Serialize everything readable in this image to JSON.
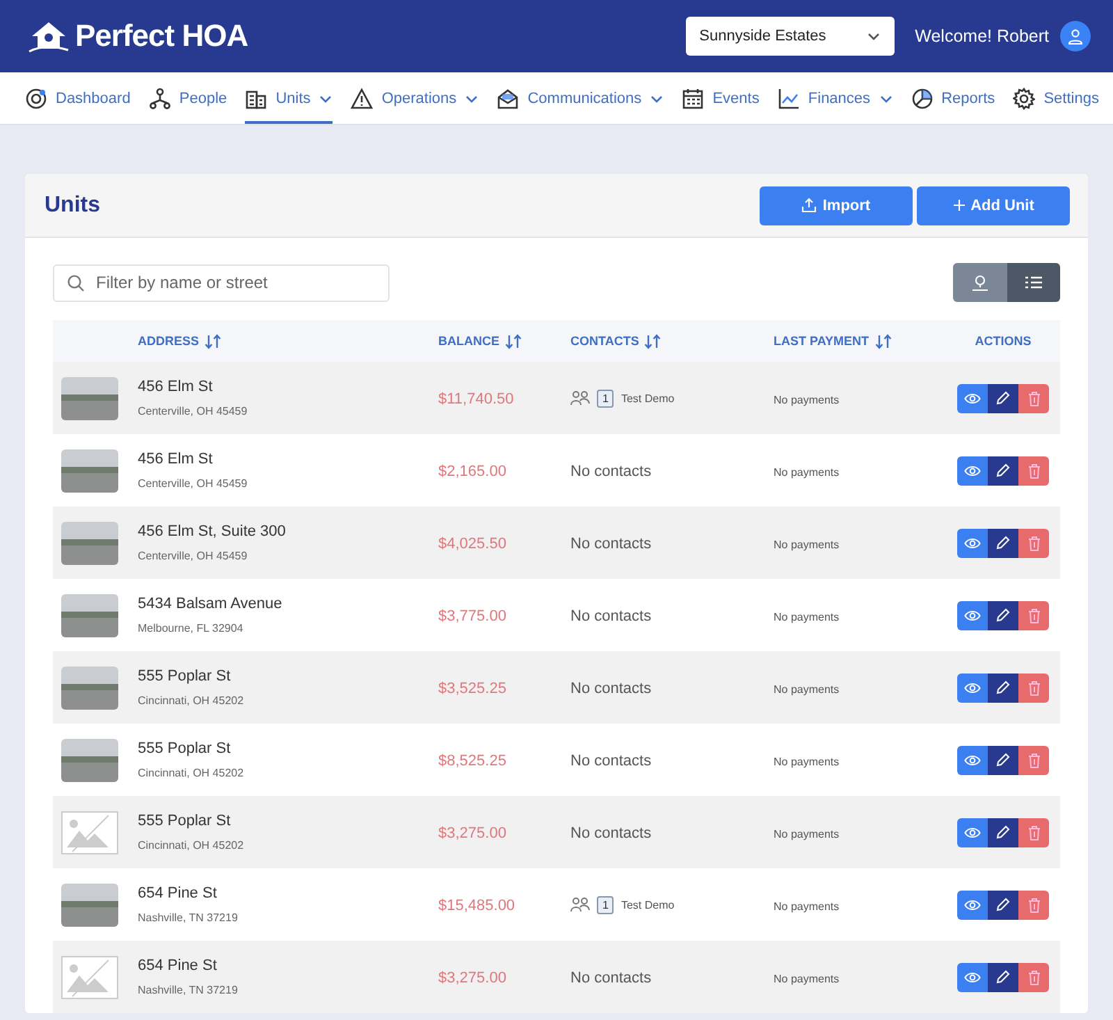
{
  "header": {
    "logo": "Perfect HOA",
    "community_select": "Sunnyside Estates",
    "welcome": "Welcome! Robert"
  },
  "nav": [
    {
      "label": "Dashboard",
      "menu": false,
      "selected": false
    },
    {
      "label": "People",
      "menu": false,
      "selected": false
    },
    {
      "label": "Units",
      "menu": true,
      "selected": true
    },
    {
      "label": "Operations",
      "menu": true,
      "selected": false
    },
    {
      "label": "Communications",
      "menu": true,
      "selected": false
    },
    {
      "label": "Events",
      "menu": false,
      "selected": false
    },
    {
      "label": "Finances",
      "menu": true,
      "selected": false
    },
    {
      "label": "Reports",
      "menu": false,
      "selected": false
    },
    {
      "label": "Settings",
      "menu": false,
      "selected": false
    }
  ],
  "page": {
    "title": "Units",
    "buttons": [
      "Import",
      "Add Unit"
    ]
  },
  "filter": {
    "placeholder": "Filter by name or street"
  },
  "view_toggle": [
    {
      "kind": "map",
      "selected": false
    },
    {
      "kind": "list",
      "selected": true
    }
  ],
  "table": {
    "columns": [
      "ADDRESS",
      "BALANCE",
      "CONTACTS",
      "LAST PAYMENT",
      "ACTIONS"
    ],
    "rows": [
      {
        "kind": "photo",
        "street": "456 Elm St",
        "city": "Centerville, OH 45459",
        "balance": "$11,740.50",
        "contacts": {
          "count": "1",
          "name": "Test Demo"
        },
        "last_payment": "No payments"
      },
      {
        "kind": "photo",
        "street": "456 Elm St",
        "city": "Centerville, OH 45459",
        "balance": "$2,165.00",
        "contacts_text": "No contacts",
        "last_payment": "No payments"
      },
      {
        "kind": "photo",
        "street": "456 Elm St, Suite 300",
        "city": "Centerville, OH 45459",
        "balance": "$4,025.50",
        "contacts_text": "No contacts",
        "last_payment": "No payments"
      },
      {
        "kind": "photo",
        "street": "5434 Balsam Avenue",
        "city": "Melbourne, FL 32904",
        "balance": "$3,775.00",
        "contacts_text": "No contacts",
        "last_payment": "No payments"
      },
      {
        "kind": "photo",
        "street": "555 Poplar St",
        "city": "Cincinnati, OH 45202",
        "balance": "$3,525.25",
        "contacts_text": "No contacts",
        "last_payment": "No payments"
      },
      {
        "kind": "photo",
        "street": "555 Poplar St",
        "city": "Cincinnati, OH 45202",
        "balance": "$8,525.25",
        "contacts_text": "No contacts",
        "last_payment": "No payments"
      },
      {
        "kind": "no-image",
        "street": "555 Poplar St",
        "city": "Cincinnati, OH 45202",
        "balance": "$3,275.00",
        "contacts_text": "No contacts",
        "last_payment": "No payments"
      },
      {
        "kind": "photo",
        "street": "654 Pine St",
        "city": "Nashville, TN 37219",
        "balance": "$15,485.00",
        "contacts": {
          "count": "1",
          "name": "Test Demo"
        },
        "last_payment": "No payments"
      },
      {
        "kind": "no-image",
        "street": "654 Pine St",
        "city": "Nashville, TN 37219",
        "balance": "$3,275.00",
        "contacts_text": "No contacts",
        "last_payment": "No payments"
      }
    ]
  }
}
